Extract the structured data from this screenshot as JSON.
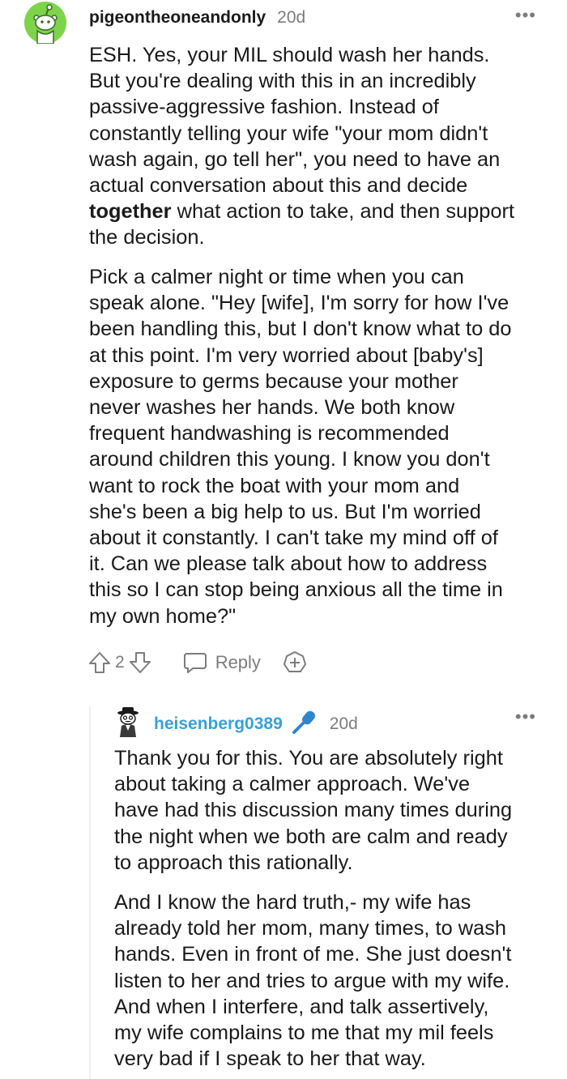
{
  "comment": {
    "username": "pigeontheoneandonly",
    "age": "20d",
    "more_label": "•••",
    "paragraph1": [
      {
        "text": "ESH. Yes, your MIL should wash her hands."
      },
      {
        "text": "But you're dealing with this in an incredibly"
      },
      {
        "text": "passive-aggressive fashion. Instead of"
      },
      {
        "text": "constantly telling your wife \"your mom didn't"
      },
      {
        "text": "wash again, go tell her\", you need to have an"
      },
      {
        "text": "actual conversation about this and decide"
      },
      {
        "bold": "together",
        "text": " what action to take, and then support"
      },
      {
        "text": "the decision."
      }
    ],
    "paragraph2": [
      "Pick a calmer night or time when you can",
      "speak alone. \"Hey [wife], I'm sorry for how I've",
      "been handling this, but I don't know what to do",
      "at this point. I'm very worried about [baby's]",
      "exposure to germs because your mother",
      "never washes her hands. We both know",
      "frequent handwashing is recommended",
      "around children this young. I know you don't",
      "want to rock the boat with your mom and",
      "she's been a big help to us. But I'm worried",
      "about it constantly. I can't take my mind off of",
      "it. Can we please talk about how to address",
      "this so I can stop being anxious all the time in",
      "my own home?\""
    ],
    "actions": {
      "upvote_icon": "arrow-up-icon",
      "vote_count": "2",
      "downvote_icon": "arrow-down-icon",
      "reply_icon": "speech-bubble-icon",
      "reply_label": "Reply",
      "award_icon": "award-plus-icon"
    }
  },
  "reply": {
    "username": "heisenberg0389",
    "user_badge_icon": "microphone-icon",
    "age": "20d",
    "more_label": "•••",
    "paragraph1": [
      "Thank you for this. You are absolutely right",
      "about taking a calmer approach. We've",
      "have had this discussion many times during",
      "the night when we both are calm and ready",
      "to approach this rationally."
    ],
    "paragraph2": [
      "And I know the hard truth,- my wife has",
      "already told her mom, many times, to wash",
      "hands. Even in front of me. She just doesn't",
      "listen to her and tries to argue with my wife.",
      "And when I interfere, and talk assertively,",
      "my wife complains to me that my mil feels",
      "very bad if I speak to her that way."
    ]
  },
  "colors": {
    "avatar_green": "#7dd44a",
    "reply_username": "#3a9fd8",
    "meta_gray": "#7c7c7c",
    "text": "#1a1a1b"
  }
}
